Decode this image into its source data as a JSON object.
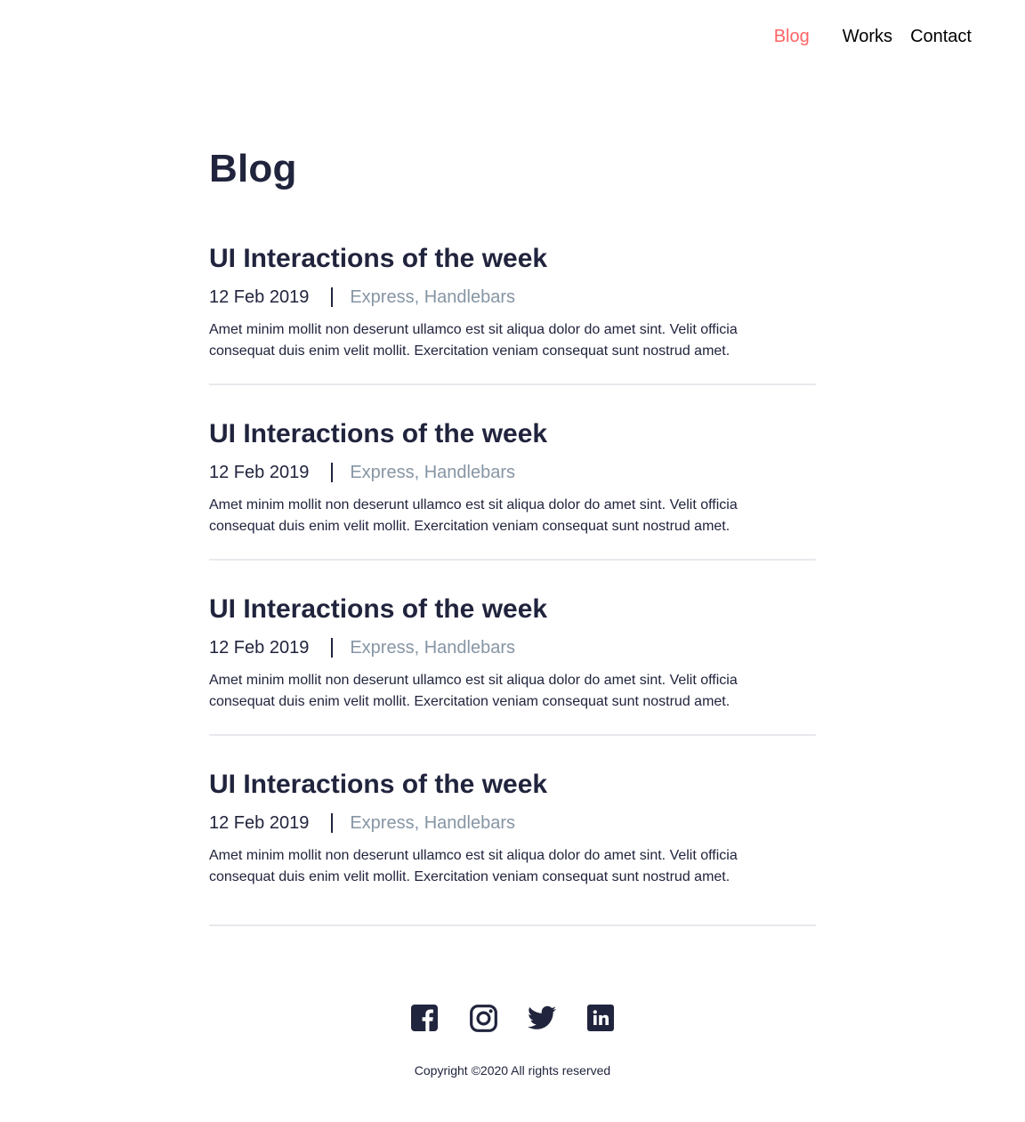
{
  "nav": {
    "items": [
      {
        "label": "Blog",
        "active": true
      },
      {
        "label": "Works",
        "active": false
      },
      {
        "label": "Contact",
        "active": false
      }
    ]
  },
  "main": {
    "title": "Blog",
    "posts": [
      {
        "title": "UI Interactions of the week",
        "date": "12 Feb 2019",
        "tags": "Express, Handlebars",
        "body": "Amet minim mollit non deserunt ullamco est sit aliqua dolor do amet sint. Velit officia consequat duis enim velit mollit. Exercitation veniam consequat sunt nostrud amet."
      },
      {
        "title": "UI Interactions of the week",
        "date": "12 Feb 2019",
        "tags": "Express, Handlebars",
        "body": "Amet minim mollit non deserunt ullamco est sit aliqua dolor do amet sint. Velit officia consequat duis enim velit mollit. Exercitation veniam consequat sunt nostrud amet."
      },
      {
        "title": "UI Interactions of the week",
        "date": "12 Feb 2019",
        "tags": "Express, Handlebars",
        "body": "Amet minim mollit non deserunt ullamco est sit aliqua dolor do amet sint. Velit officia consequat duis enim velit mollit. Exercitation veniam consequat sunt nostrud amet."
      },
      {
        "title": "UI Interactions of the week",
        "date": "12 Feb 2019",
        "tags": "Express, Handlebars",
        "body": "Amet minim mollit non deserunt ullamco est sit aliqua dolor do amet sint. Velit officia consequat duis enim velit mollit. Exercitation veniam consequat sunt nostrud amet."
      }
    ]
  },
  "footer": {
    "socials": [
      "facebook-icon",
      "instagram-icon",
      "twitter-icon",
      "linkedin-icon"
    ],
    "copyright": "Copyright ©2020 All rights reserved"
  },
  "colors": {
    "accent": "#ff6464",
    "text": "#21243d",
    "muted": "#8695a4",
    "divider": "#e8e9ee"
  }
}
